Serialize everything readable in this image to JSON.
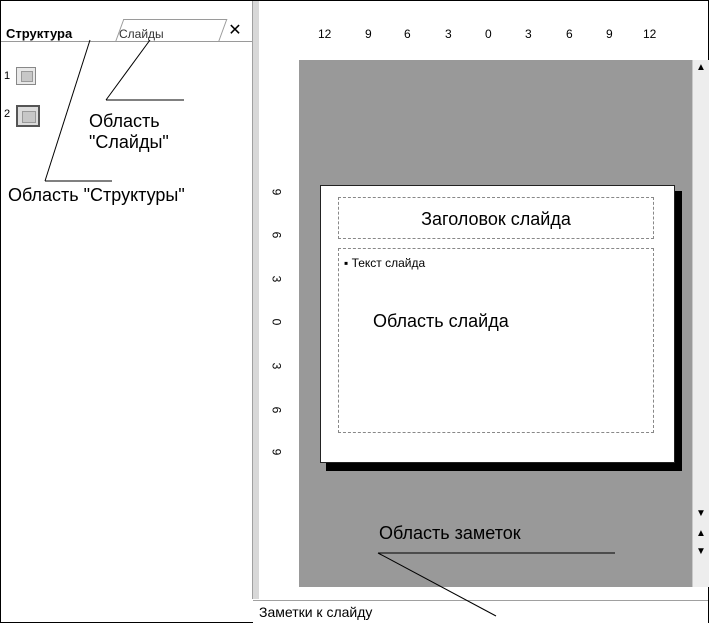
{
  "left_panel": {
    "tabs": [
      {
        "label": "Структура"
      },
      {
        "label": "Слайды"
      }
    ],
    "close_symbol": "✕",
    "slides": [
      {
        "number": "1"
      },
      {
        "number": "2"
      }
    ],
    "callout_slides_area": "Область\n\"Слайды\"",
    "callout_outline_area": "Область \"Структуры\""
  },
  "rulers": {
    "horizontal": [
      "12",
      "9",
      "6",
      "3",
      "0",
      "3",
      "6",
      "9",
      "12"
    ],
    "vertical": [
      "9",
      "6",
      "3",
      "0",
      "3",
      "6",
      "9"
    ]
  },
  "slide": {
    "title_placeholder": "Заголовок слайда",
    "body_bullet": "▪ Текст слайда",
    "area_label": "Область слайда"
  },
  "notes": {
    "callout": "Область заметок",
    "placeholder": "Заметки к слайду"
  },
  "colors": {
    "canvas": "#999999",
    "slide": "#ffffff",
    "shadow": "#000000"
  }
}
